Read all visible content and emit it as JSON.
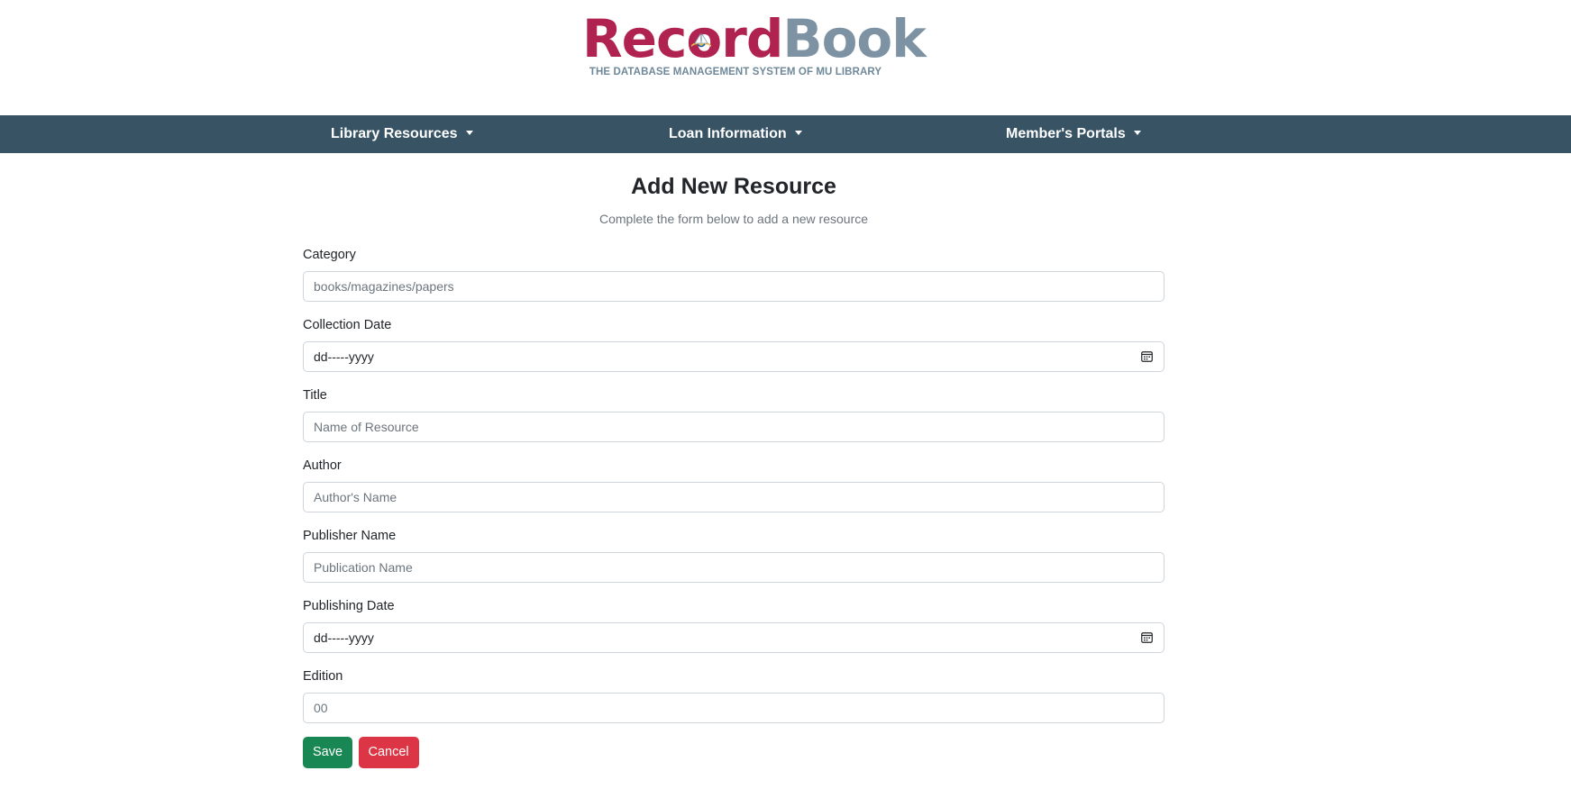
{
  "brand": {
    "logo_part1": "Rec",
    "logo_o": "o",
    "logo_part2": "rd",
    "logo_part3": "Book",
    "tagline": "THE DATABASE MANAGEMENT SYSTEM OF MU LIBRARY",
    "color_primary": "#b0224f",
    "color_secondary": "#7d93a4"
  },
  "nav": {
    "background": "#375364",
    "items": [
      {
        "label": "Library Resources"
      },
      {
        "label": "Loan Information"
      },
      {
        "label": "Member's Portals"
      }
    ]
  },
  "page": {
    "title": "Add New Resource",
    "subtitle": "Complete the form below to add a new resource"
  },
  "form": {
    "category": {
      "label": "Category",
      "placeholder": "books/magazines/papers"
    },
    "collection_date": {
      "label": "Collection Date",
      "value": "dd-----yyyy"
    },
    "title": {
      "label": "Title",
      "placeholder": "Name of Resource"
    },
    "author": {
      "label": "Author",
      "placeholder": "Author's Name"
    },
    "publisher": {
      "label": "Publisher Name",
      "placeholder": "Publication Name"
    },
    "publishing_date": {
      "label": "Publishing Date",
      "value": "dd-----yyyy"
    },
    "edition": {
      "label": "Edition",
      "placeholder": "00"
    },
    "save_label": "Save",
    "cancel_label": "Cancel"
  },
  "icons": {
    "calendar": "calendar-icon",
    "dropdown": "chevron-down-icon"
  }
}
